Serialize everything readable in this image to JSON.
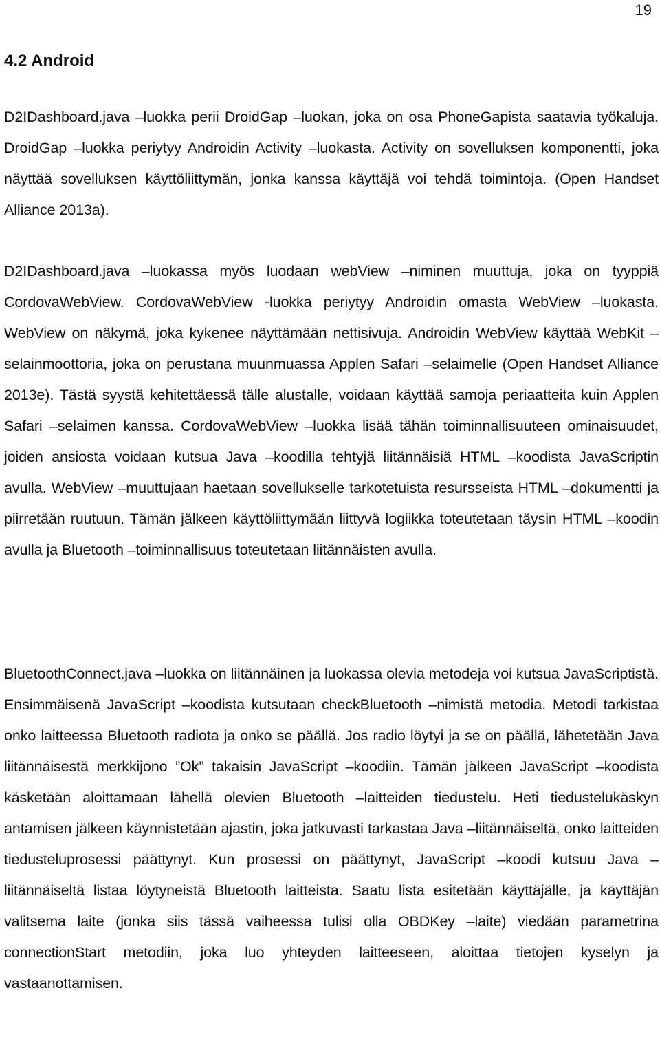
{
  "page": {
    "number": "19",
    "heading": "4.2 Android",
    "paragraphs": [
      "D2IDashboard.java –luokka perii DroidGap –luokan, joka on osa PhoneGapista saatavia työkaluja. DroidGap –luokka periytyy Androidin Activity –luokasta. Activity on sovelluksen komponentti, joka näyttää sovelluksen käyttöliittymän, jonka kanssa käyttäjä voi tehdä toimintoja. (Open Handset Alliance 2013a).",
      "D2IDashboard.java –luokassa myös luodaan webView –niminen muuttuja, joka on tyyppiä CordovaWebView. CordovaWebView -luokka periytyy Androidin omasta WebView –luokasta. WebView on näkymä, joka kykenee näyttämään nettisivuja. Androidin WebView käyttää WebKit –selainmoottoria, joka on perustana muunmuassa Applen Safari –selaimelle (Open Handset Alliance 2013e). Tästä syystä kehitettäessä tälle alustalle, voidaan käyttää samoja periaatteita kuin Applen Safari –selaimen kanssa. CordovaWebView –luokka lisää tähän toiminnallisuuteen ominaisuudet, joiden ansiosta voidaan kutsua Java –koodilla tehtyjä liitännäisiä HTML –koodista JavaScriptin avulla. WebView –muuttujaan haetaan sovellukselle tarkotetuista resursseista HTML –dokumentti ja piirretään ruutuun. Tämän jälkeen käyttöliittymään liittyvä logiikka toteutetaan täysin HTML –koodin avulla ja Bluetooth –toiminnallisuus toteutetaan liitännäisten avulla.",
      "BluetoothConnect.java –luokka on liitännäinen ja luokassa olevia metodeja voi kutsua JavaScriptistä. Ensimmäisenä JavaScript –koodista kutsutaan checkBluetooth –nimistä metodia. Metodi tarkistaa onko laitteessa Bluetooth radiota ja onko se päällä. Jos radio löytyi ja se on päällä, lähetetään Java liitännäisestä merkkijono ”Ok” takaisin JavaScript –koodiin. Tämän jälkeen JavaScript –koodista käsketään aloittamaan lähellä olevien Bluetooth –laitteiden tiedustelu. Heti tiedustelukäskyn antamisen jälkeen käynnistetään ajastin, joka jatkuvasti tarkastaa Java –liitännäiseltä, onko laitteiden tiedusteluprosessi päättynyt. Kun prosessi on päättynyt, JavaScript –koodi kutsuu Java –liitännäiseltä listaa löytyneistä Bluetooth laitteista. Saatu lista esitetään käyttäjälle, ja käyttäjän valitsema laite (jonka siis tässä vaiheessa tulisi olla OBDKey –laite) viedään parametrina connectionStart metodiin, joka luo yhteyden laitteeseen, aloittaa tietojen kyselyn ja vastaanottamisen."
    ]
  }
}
